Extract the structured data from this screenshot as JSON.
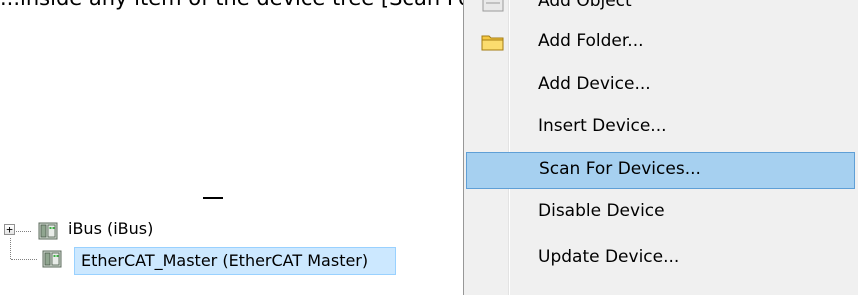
{
  "background_text": "...inside any item of the device tree [Scan For Devices]...",
  "tree": {
    "items": [
      {
        "label": "iBus (iBus)",
        "expander": "+",
        "icon": "device-icon"
      },
      {
        "label": "EtherCAT_Master (EtherCAT Master)",
        "icon": "device-icon",
        "selected": true
      }
    ]
  },
  "context_menu": {
    "items": [
      {
        "label": "Add Object",
        "icon": "add-object-icon"
      },
      {
        "label": "Add Folder...",
        "icon": "folder-icon"
      },
      {
        "label": "Add Device..."
      },
      {
        "label": "Insert Device..."
      },
      {
        "label": "Scan For Devices...",
        "highlighted": true
      },
      {
        "label": "Disable Device"
      },
      {
        "label": "Update Device..."
      }
    ]
  },
  "colors": {
    "menu_background": "#f0f0f0",
    "menu_highlight": "#a6d0f0",
    "menu_highlight_border": "#5f9fd6",
    "tree_selection": "#cce8ff",
    "tree_selection_border": "#99d1ff",
    "folder_yellow": "#f5c842"
  }
}
